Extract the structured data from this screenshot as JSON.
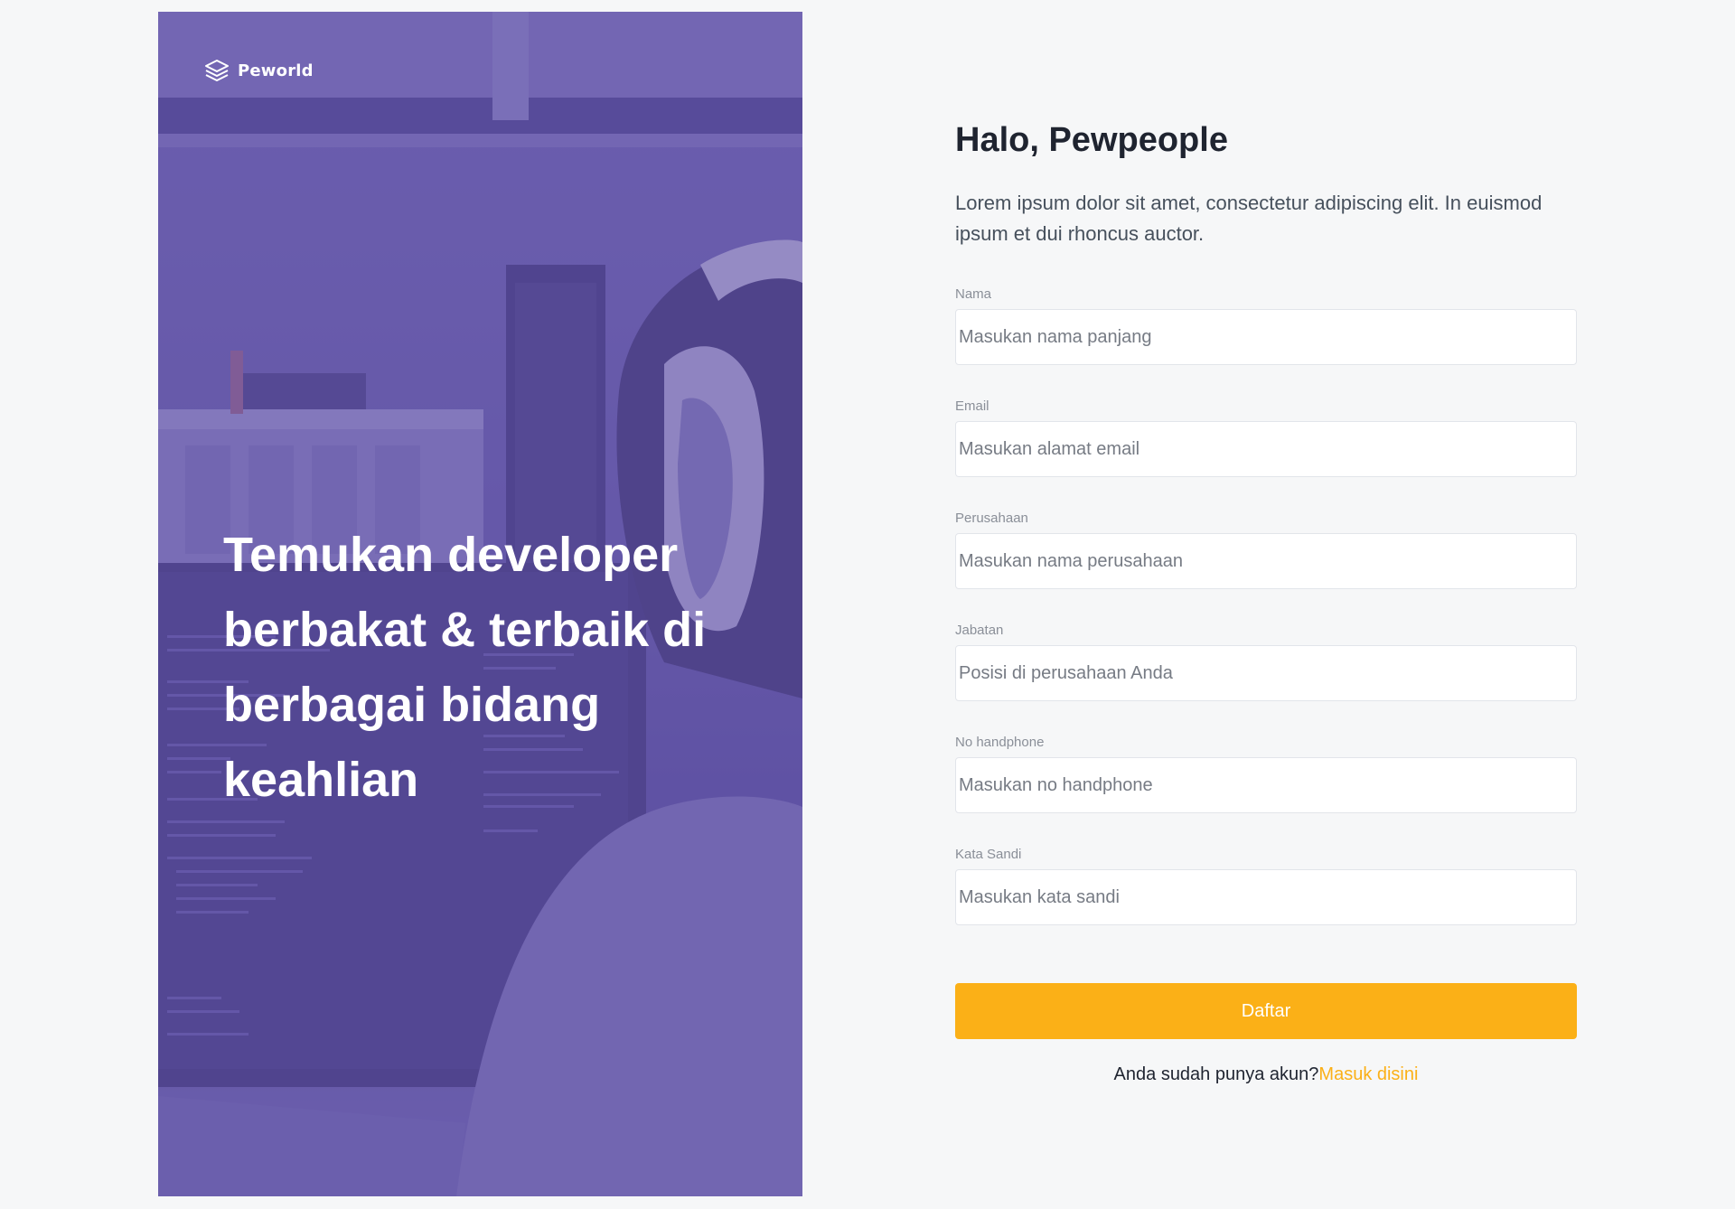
{
  "brand": {
    "name": "Peworld",
    "icon": "stacked-layers-icon"
  },
  "hero": {
    "headline": "Temukan developer berbakat & terbaik di berbagai bidang keahlian"
  },
  "form": {
    "title": "Halo, Pewpeople",
    "subtitle": "Lorem ipsum dolor sit amet, consectetur adipiscing elit. In euismod ipsum et dui rhoncus auctor.",
    "fields": {
      "nama": {
        "label": "Nama",
        "placeholder": "Masukan nama panjang"
      },
      "email": {
        "label": "Email",
        "placeholder": "Masukan alamat email"
      },
      "perusahaan": {
        "label": "Perusahaan",
        "placeholder": "Masukan nama perusahaan"
      },
      "jabatan": {
        "label": "Jabatan",
        "placeholder": "Posisi di perusahaan Anda"
      },
      "handphone": {
        "label": "No handphone",
        "placeholder": "Masukan no handphone"
      },
      "sandi": {
        "label": "Kata Sandi",
        "placeholder": "Masukan kata sandi"
      }
    },
    "submit_label": "Daftar",
    "login_prompt": "Anda sudah punya akun?",
    "login_link": "Masuk disini"
  },
  "colors": {
    "accent": "#fbb017",
    "hero_overlay": "#5e50a1",
    "background": "#f6f7f8"
  }
}
